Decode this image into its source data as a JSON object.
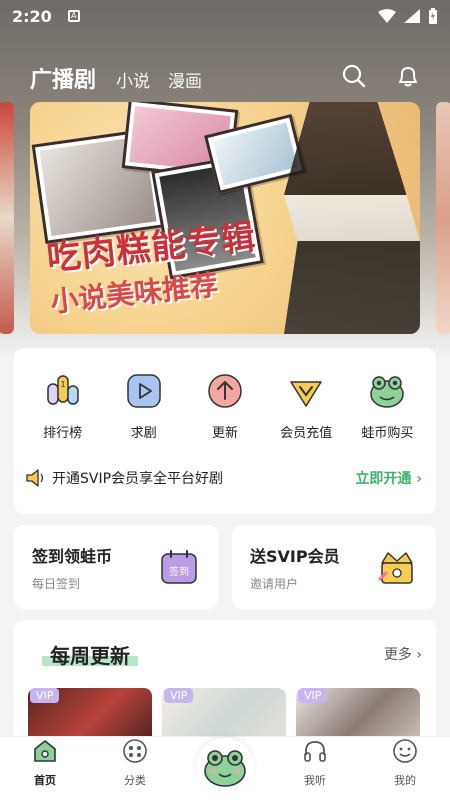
{
  "status_bar": {
    "time": "2:20",
    "sim_label": "A"
  },
  "header": {
    "tabs": [
      {
        "label": "广播剧",
        "active": true
      },
      {
        "label": "小说",
        "active": false
      },
      {
        "label": "漫画",
        "active": false
      }
    ],
    "search_icon": "search-icon",
    "bell_icon": "bell-icon"
  },
  "banner": {
    "line1": "吃肉糕能专辑",
    "line2": "小说美味推荐"
  },
  "quick_menu": [
    {
      "label": "排行榜",
      "icon": "ranking-icon"
    },
    {
      "label": "求剧",
      "icon": "play-request-icon"
    },
    {
      "label": "更新",
      "icon": "update-arrow-icon"
    },
    {
      "label": "会员充值",
      "icon": "vip-recharge-icon"
    },
    {
      "label": "蛙币购买",
      "icon": "frog-coin-icon"
    }
  ],
  "vip_promo": {
    "text": "开通SVIP会员享全平台好剧",
    "cta": "立即开通"
  },
  "cards": {
    "checkin": {
      "title": "签到领蛙币",
      "subtitle": "每日签到",
      "icon_text": "签到"
    },
    "invite": {
      "title": "送SVIP会员",
      "subtitle": "邀请用户"
    }
  },
  "weekly": {
    "title": "每周更新",
    "more": "更多",
    "items": [
      {
        "badge": "VIP"
      },
      {
        "badge": "VIP"
      },
      {
        "badge": "VIP"
      }
    ]
  },
  "tabbar": [
    {
      "label": "首页",
      "icon": "home-icon",
      "active": true
    },
    {
      "label": "分类",
      "icon": "category-icon",
      "active": false
    },
    {
      "label": "",
      "icon": "frog-icon",
      "active": false
    },
    {
      "label": "我听",
      "icon": "headphones-icon",
      "active": false
    },
    {
      "label": "我的",
      "icon": "profile-icon",
      "active": false
    }
  ],
  "colors": {
    "accent_green": "#3bb36b",
    "vip_badge": "#c7b5f0",
    "banner_red": "#c9323a"
  }
}
